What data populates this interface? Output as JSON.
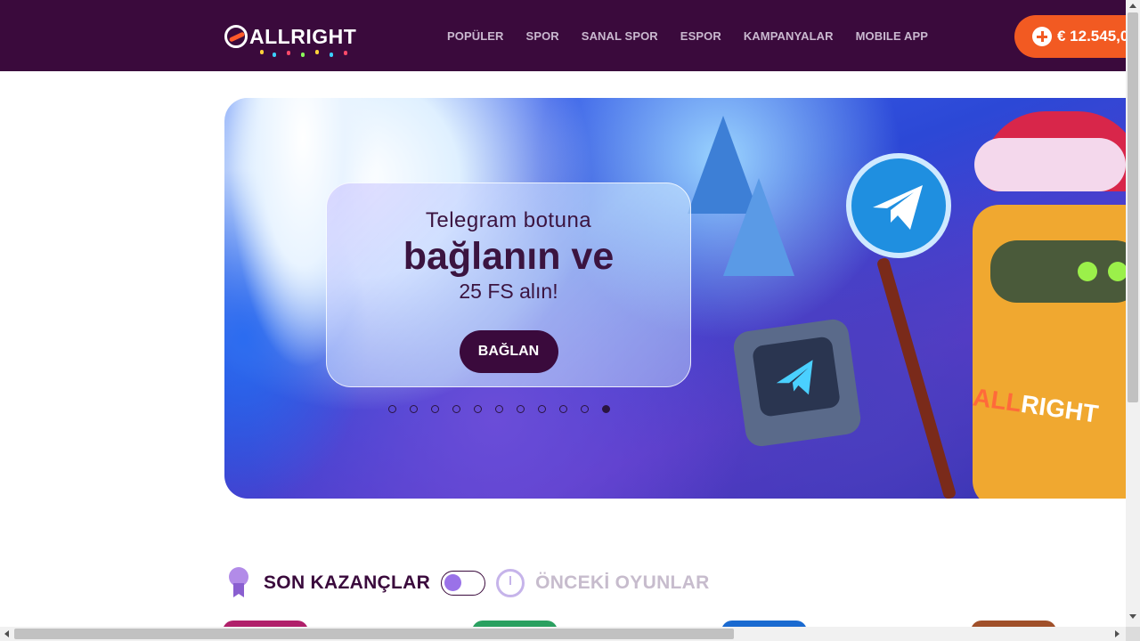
{
  "header": {
    "logo_text": "ALLRIGHT",
    "nav": [
      "POPÜLER",
      "SPOR",
      "SANAL SPOR",
      "ESPOR",
      "KAMPANYALAR",
      "MOBILE APP"
    ],
    "balance": "€ 12.545,0",
    "balance_icon": "plus-circle-icon"
  },
  "banner": {
    "line1": "Telegram botuna",
    "line2": "bağlanın ve",
    "line3": "25 FS alın!",
    "button": "BAĞLAN",
    "slide_count": 11,
    "active_slide": 11,
    "robot_text_a": "ALL",
    "robot_text_b": "RIGHT"
  },
  "section": {
    "title": "SON KAZANÇLAR",
    "title_secondary": "ÖNCEKİ OYUNLAR",
    "medal_icon": "medal-icon",
    "clock_icon": "clock-icon"
  },
  "colors": {
    "header_bg": "#3a0a3c",
    "accent": "#f25a22",
    "text_dark": "#3a0a3c",
    "muted": "#c7bccd"
  }
}
